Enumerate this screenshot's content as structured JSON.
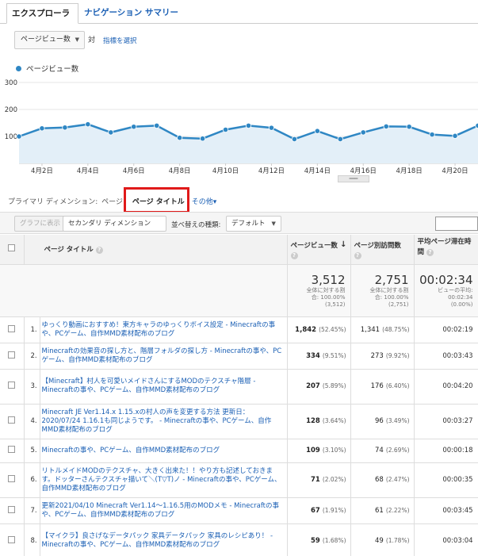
{
  "tabs": {
    "explorer": "エクスプローラ",
    "nav_summary": "ナビゲーション サマリー"
  },
  "metric": {
    "selected": "ページビュー数",
    "vs": "対",
    "pick": "指標を選択"
  },
  "legend": {
    "label": "ページビュー数",
    "color": "#2f87c4"
  },
  "chart_data": {
    "type": "line",
    "ylim": [
      0,
      300
    ],
    "yticks": [
      "300",
      "200",
      "100"
    ],
    "xticks": [
      "4月2日",
      "4月4日",
      "4月6日",
      "4月8日",
      "4月10日",
      "4月12日",
      "4月14日",
      "4月16日",
      "4月18日",
      "4月20日"
    ],
    "series": [
      {
        "name": "ページビュー数",
        "values": [
          100,
          130,
          133,
          145,
          115,
          136,
          140,
          95,
          92,
          125,
          140,
          132,
          90,
          120,
          90,
          115,
          137,
          136,
          107,
          102,
          140
        ]
      }
    ]
  },
  "primary": {
    "label": "プライマリ ディメンション:",
    "page": "ページ",
    "page_title": "ページ タイトル",
    "other": "その他"
  },
  "toolbar": {
    "graph_btn": "グラフに表示",
    "secondary": "セカンダリ ディメンション",
    "sort_type": "並べ替えの種類:",
    "sort_default": "デフォルト"
  },
  "table": {
    "headers": {
      "title": "ページ タイトル",
      "pv": "ページビュー数",
      "uv": "ページ別訪問数",
      "avg": "平均ページ滞在時間"
    },
    "totals": {
      "pv": "3,512",
      "pv_sub1": "全体に対する割",
      "pv_sub2": "合: 100.00%",
      "pv_sub3": "(3,512)",
      "uv": "2,751",
      "uv_sub1": "全体に対する割",
      "uv_sub2": "合: 100.00%",
      "uv_sub3": "(2,751)",
      "avg": "00:02:34",
      "avg_sub1": "ビューの平均:",
      "avg_sub2": "00:02:34",
      "avg_sub3": "(0.00%)"
    },
    "rows": [
      {
        "idx": "1.",
        "title": "ゆっくり動画におすすめ！東方キャラのゆっくりボイス設定 - Minecraftの事や、PCゲーム、自作MMD素材配布のブログ",
        "pv": "1,842",
        "pv_pct": "(52.45%)",
        "uv": "1,341",
        "uv_pct": "(48.75%)",
        "avg": "00:02:19"
      },
      {
        "idx": "2.",
        "title": "Minecraftの効果音の探し方と、階層フォルダの探し方 - Minecraftの事や、PCゲーム、自作MMD素材配布のブログ",
        "pv": "334",
        "pv_pct": "(9.51%)",
        "uv": "273",
        "uv_pct": "(9.92%)",
        "avg": "00:03:43"
      },
      {
        "idx": "3.",
        "title": "【Minecraft】村人を可愛いメイドさんにするMODのテクスチャ階層 - Minecraftの事や、PCゲーム、自作MMD素材配布のブログ",
        "pv": "207",
        "pv_pct": "(5.89%)",
        "uv": "176",
        "uv_pct": "(6.40%)",
        "avg": "00:04:20"
      },
      {
        "idx": "4.",
        "title": "Minecraft JE Ver1.14.x 1.15.xの村人の声を変更する方法 更新日：2020/07/24 1.16.1も同じようです。 - Minecraftの事や、PCゲーム、自作MMD素材配布のブログ",
        "pv": "128",
        "pv_pct": "(3.64%)",
        "uv": "96",
        "uv_pct": "(3.49%)",
        "avg": "00:03:27"
      },
      {
        "idx": "5.",
        "title": "Minecraftの事や、PCゲーム、自作MMD素材配布のブログ",
        "pv": "109",
        "pv_pct": "(3.10%)",
        "uv": "74",
        "uv_pct": "(2.69%)",
        "avg": "00:00:18"
      },
      {
        "idx": "6.",
        "title": "リトルメイドMODのテクスチャ、大きく出来た！！やり方も記述しておきます。ドッターさんテクスチャ描いて＼(T▽T)ノ - Minecraftの事や、PCゲーム、自作MMD素材配布のブログ",
        "pv": "71",
        "pv_pct": "(2.02%)",
        "uv": "68",
        "uv_pct": "(2.47%)",
        "avg": "00:00:35"
      },
      {
        "idx": "7.",
        "title": "更新2021/04/10 Minecraft Ver1.14～1.16.5用のMODメモ - Minecraftの事や、PCゲーム、自作MMD素材配布のブログ",
        "pv": "67",
        "pv_pct": "(1.91%)",
        "uv": "61",
        "uv_pct": "(2.22%)",
        "avg": "00:03:45"
      },
      {
        "idx": "8.",
        "title": "【マイクラ】良さげなデータパック 家具データパック 家具のレシピあり！ - Minecraftの事や、PCゲーム、自作MMD素材配布のブログ",
        "pv": "59",
        "pv_pct": "(1.68%)",
        "uv": "49",
        "uv_pct": "(1.78%)",
        "avg": "00:03:04"
      }
    ]
  }
}
